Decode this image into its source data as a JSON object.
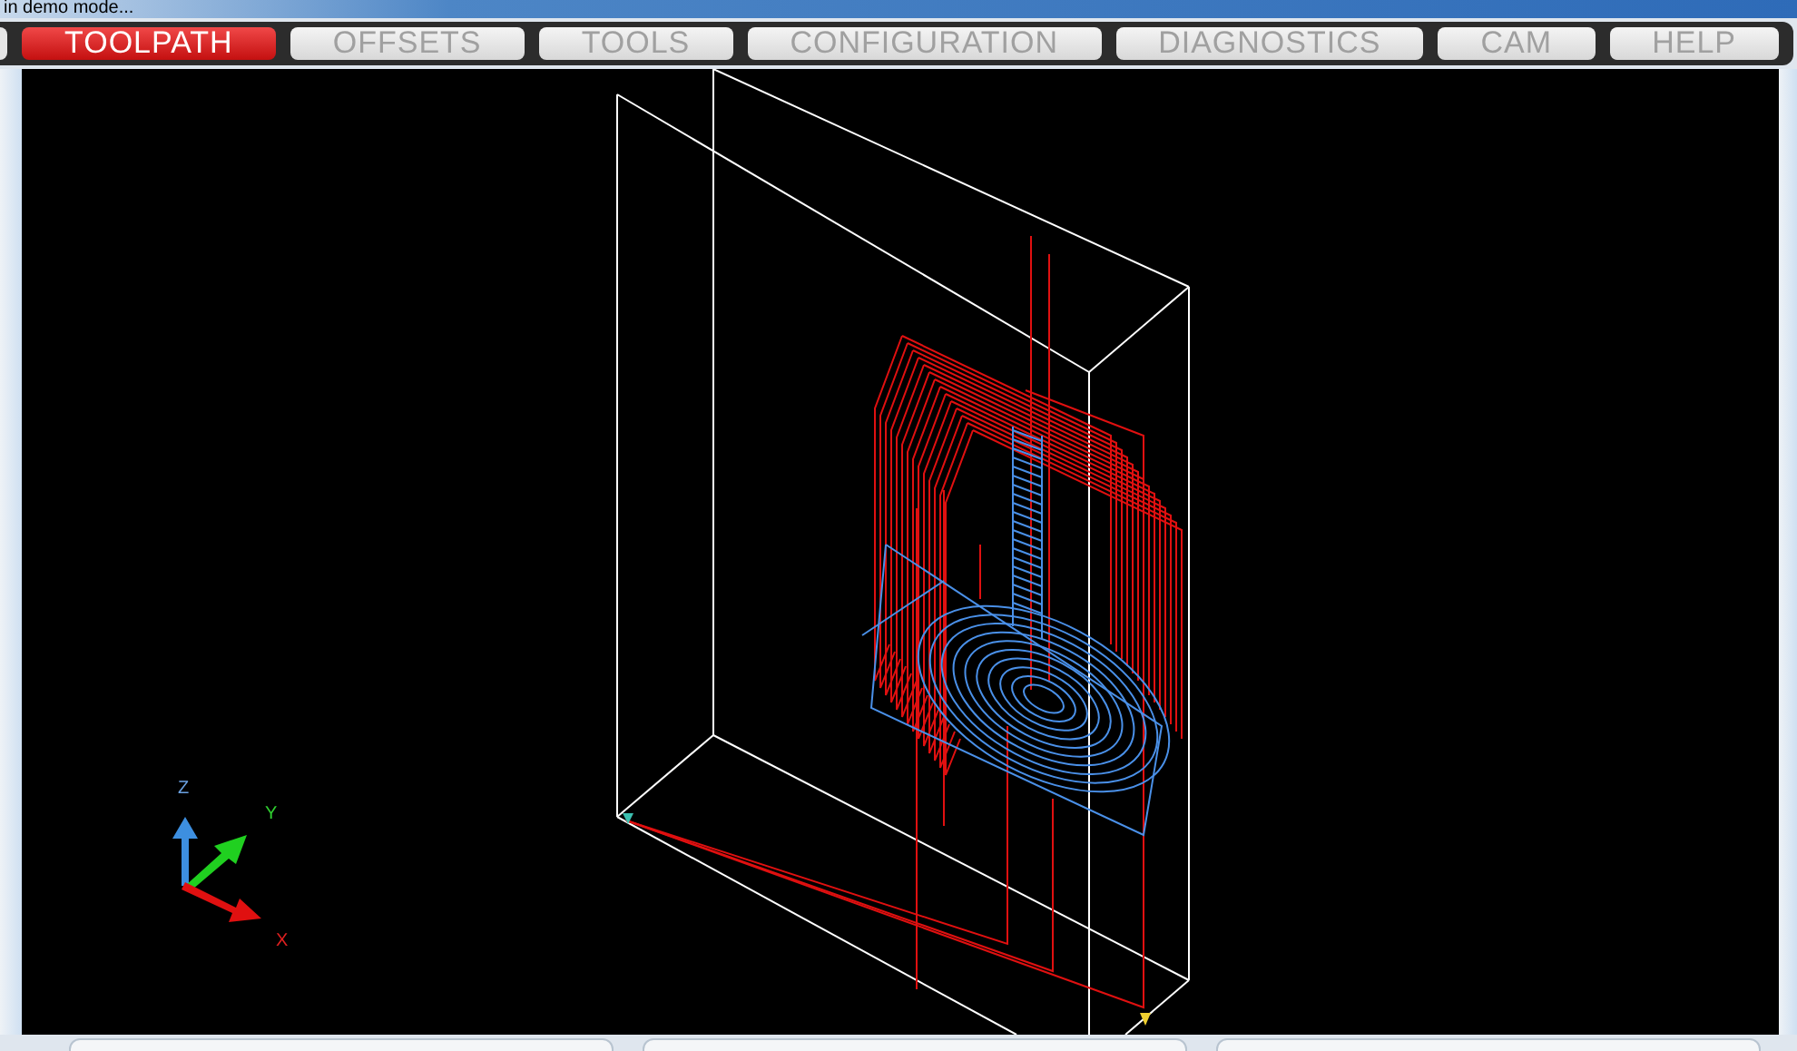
{
  "window": {
    "title": "in demo mode..."
  },
  "tabs": [
    {
      "label": "TOOLPATH",
      "selected": true
    },
    {
      "label": "OFFSETS",
      "selected": false
    },
    {
      "label": "TOOLS",
      "selected": false
    },
    {
      "label": "CONFIGURATION",
      "selected": false
    },
    {
      "label": "DIAGNOSTICS",
      "selected": false
    },
    {
      "label": "CAM",
      "selected": false
    },
    {
      "label": "HELP",
      "selected": false
    }
  ],
  "viewport": {
    "axes": {
      "x_label": "X",
      "y_label": "Y",
      "z_label": "Z"
    }
  }
}
